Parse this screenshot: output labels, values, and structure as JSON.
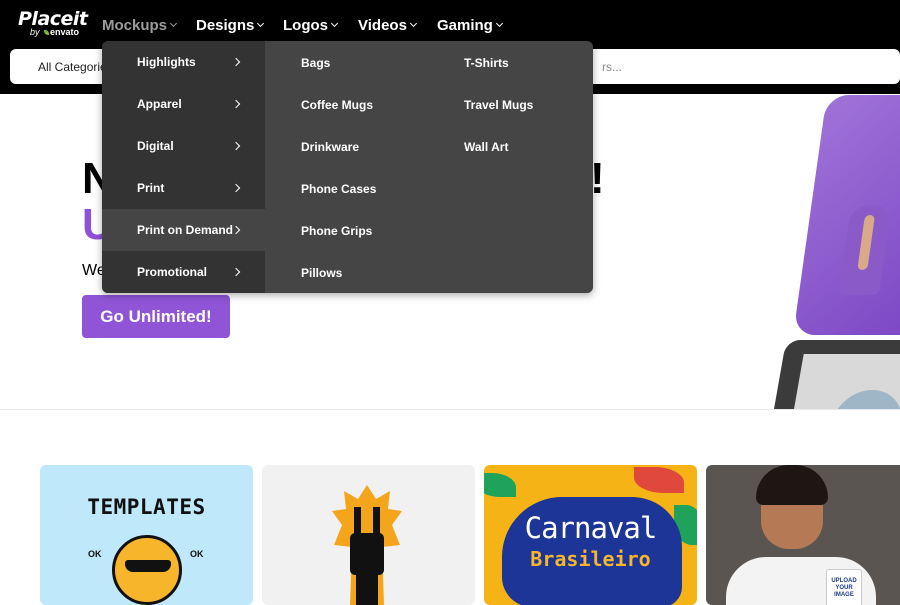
{
  "logo": {
    "main": "Placeit",
    "by": "by",
    "brand": "envato"
  },
  "nav": [
    {
      "label": "Mockups",
      "active": true
    },
    {
      "label": "Designs"
    },
    {
      "label": "Logos"
    },
    {
      "label": "Videos"
    },
    {
      "label": "Gaming"
    }
  ],
  "search": {
    "category": "All Categorie",
    "placeholder": "rs..."
  },
  "hero": {
    "n": "N",
    "excl": "!",
    "u": "U",
    "sub": "We",
    "cta": "Go Unlimited!"
  },
  "dropdown": {
    "categories": [
      "Highlights",
      "Apparel",
      "Digital",
      "Print",
      "Print on Demand",
      "Promotional"
    ],
    "active_index": 4,
    "col1": [
      "Bags",
      "Coffee Mugs",
      "Drinkware",
      "Phone Cases",
      "Phone Grips",
      "Pillows"
    ],
    "col2": [
      "T-Shirts",
      "Travel Mugs",
      "Wall Art"
    ]
  },
  "cards": {
    "templates": {
      "title": "TEMPLATES",
      "ok_left": "OK",
      "ok_right": "OK"
    },
    "carnaval": {
      "title": "Carnaval",
      "sub": "Brasileiro"
    },
    "mug": {
      "text": "UPLOAD YOUR IMAGE"
    }
  },
  "colors": {
    "accent": "#8f55d6",
    "nav_bg": "#000000",
    "dropdown_bg": "#454545",
    "dropdown_left_bg": "#333333"
  }
}
